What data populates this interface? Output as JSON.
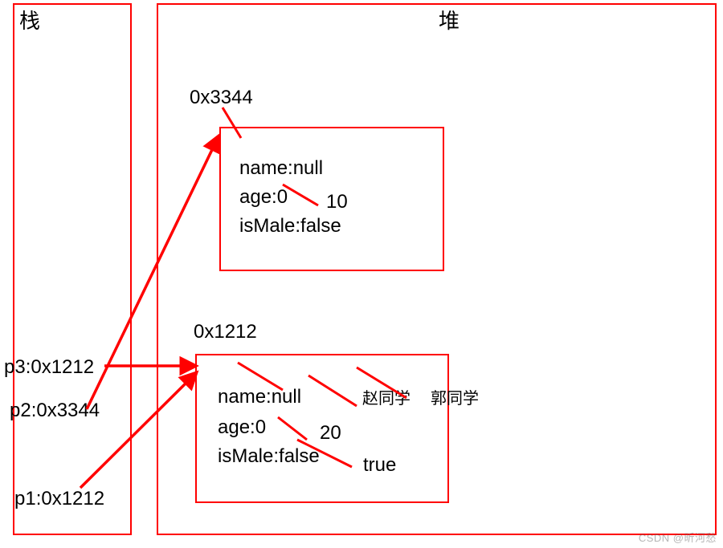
{
  "stack": {
    "title": "栈",
    "vars": {
      "p3": "p3:0x1212",
      "p2": "p2:0x3344",
      "p1": "p1:0x1212"
    }
  },
  "heap": {
    "title": "堆",
    "obj1": {
      "addr": "0x3344",
      "name_line": "name:null",
      "age_line": "age:0",
      "age_new": "10",
      "ismale_line": "isMale:false"
    },
    "obj2": {
      "addr": "0x1212",
      "name_line": "name:null",
      "name_new1": "赵同学",
      "name_new2": "郭同学",
      "age_line": "age:0",
      "age_new": "20",
      "ismale_line": "isMale:false",
      "ismale_new": "true"
    }
  },
  "watermark": "CSDN @昕河愁"
}
